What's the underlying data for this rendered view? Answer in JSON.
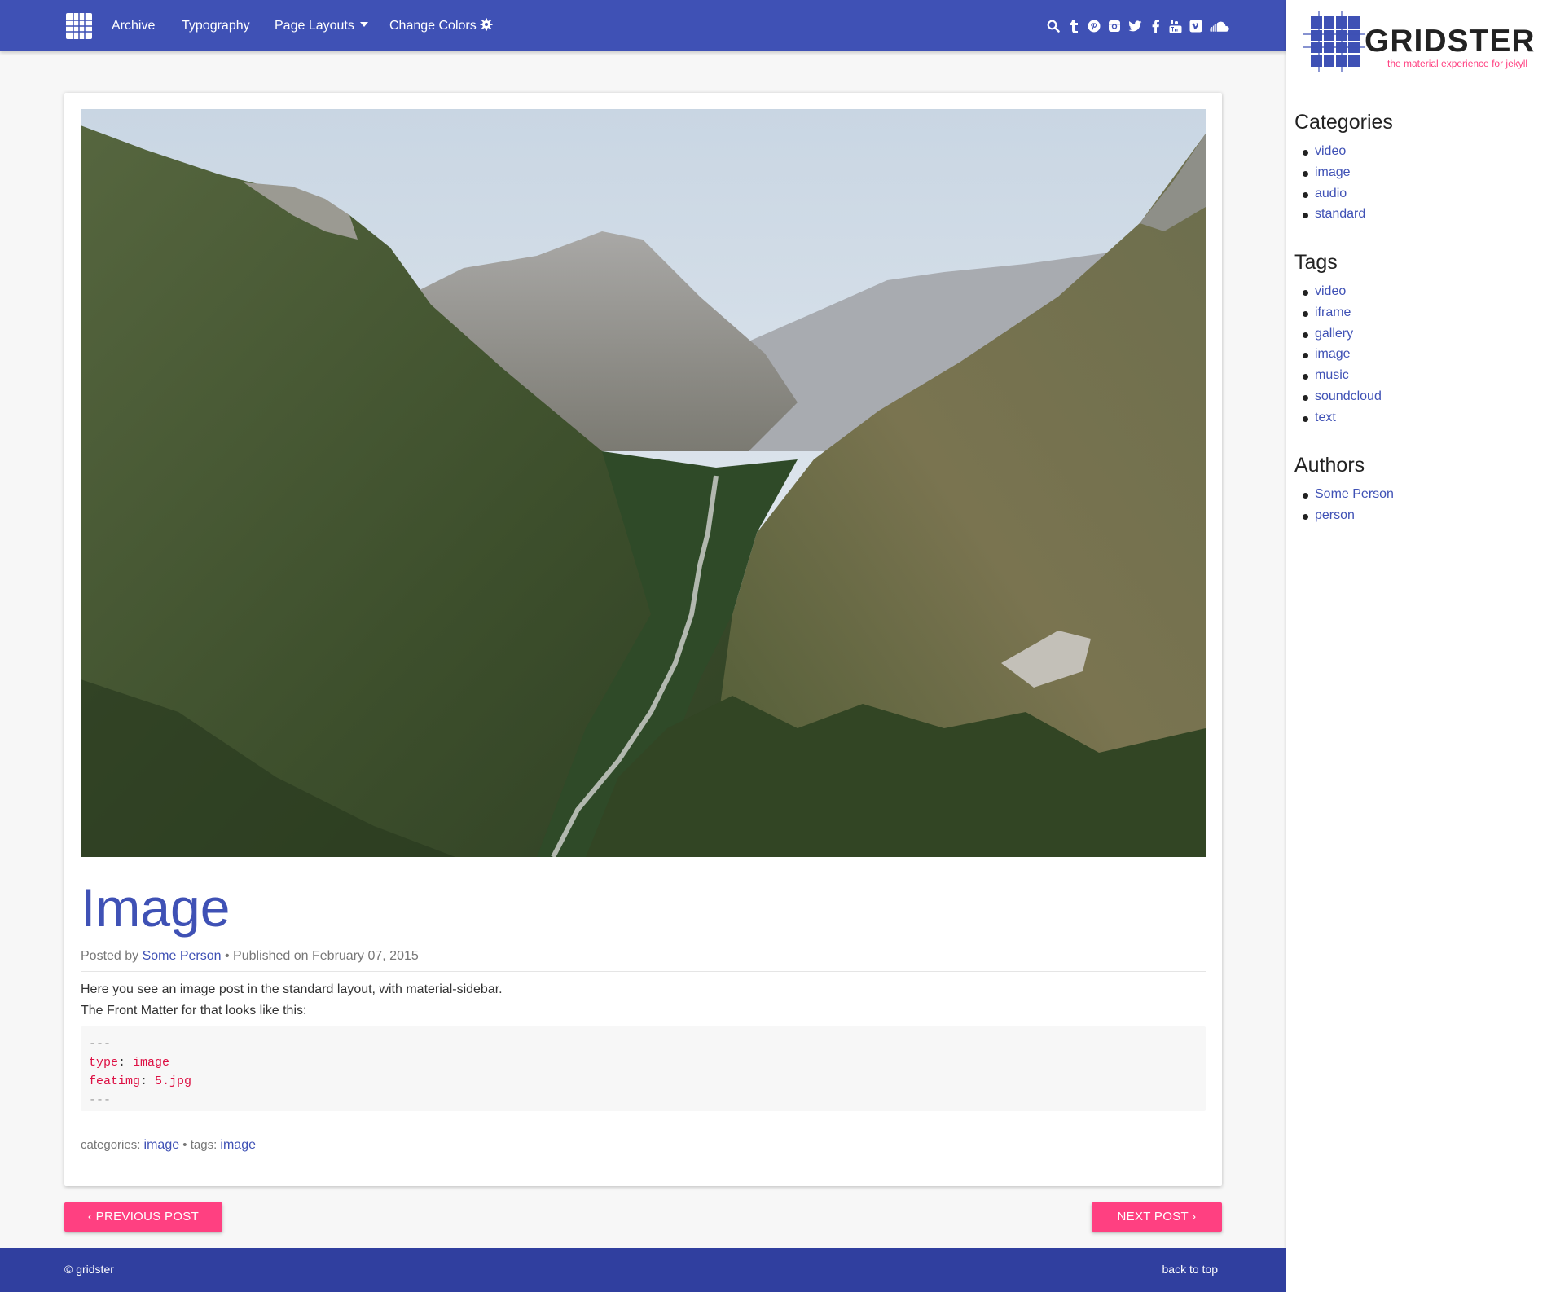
{
  "nav": {
    "items": [
      {
        "label": "Archive"
      },
      {
        "label": "Typography"
      },
      {
        "label": "Page Layouts"
      },
      {
        "label": "Change Colors"
      }
    ],
    "social_icons": [
      "search-icon",
      "tumblr-icon",
      "pinterest-icon",
      "instagram-icon",
      "twitter-icon",
      "facebook-icon",
      "youtube-icon",
      "vimeo-icon",
      "soundcloud-icon"
    ]
  },
  "brand": {
    "name": "GRIDSTER",
    "tagline": "the material experience for jekyll"
  },
  "sidebar": {
    "categories": {
      "title": "Categories",
      "items": [
        "video",
        "image",
        "audio",
        "standard"
      ]
    },
    "tags": {
      "title": "Tags",
      "items": [
        "video",
        "iframe",
        "gallery",
        "image",
        "music",
        "soundcloud",
        "text"
      ]
    },
    "authors": {
      "title": "Authors",
      "items": [
        "Some Person",
        "person"
      ]
    }
  },
  "post": {
    "title": "Image",
    "meta": {
      "posted_by": "Posted by",
      "author": "Some Person",
      "published": "• Published on February 07, 2015"
    },
    "body_line1": "Here you see an image post in the standard layout, with material-sidebar.",
    "body_line2": "The Front Matter for that looks like this:",
    "code": {
      "dash_open": "---",
      "key1": "type",
      "val1": "image",
      "key2": "featimg",
      "val2": "5.jpg",
      "dash_close": "---"
    },
    "footer": {
      "categories_label": "categories:",
      "category": "image",
      "tags_label": "• tags:",
      "tag": "image"
    }
  },
  "pagination": {
    "prev": "‹ PREVIOUS POST",
    "next": "NEXT POST ›"
  },
  "footer": {
    "copyright": "© gridster",
    "back_to_top": "back to top"
  },
  "colors": {
    "primary": "#3f51b5",
    "primary_dark": "#303f9f",
    "accent": "#ff4081"
  }
}
